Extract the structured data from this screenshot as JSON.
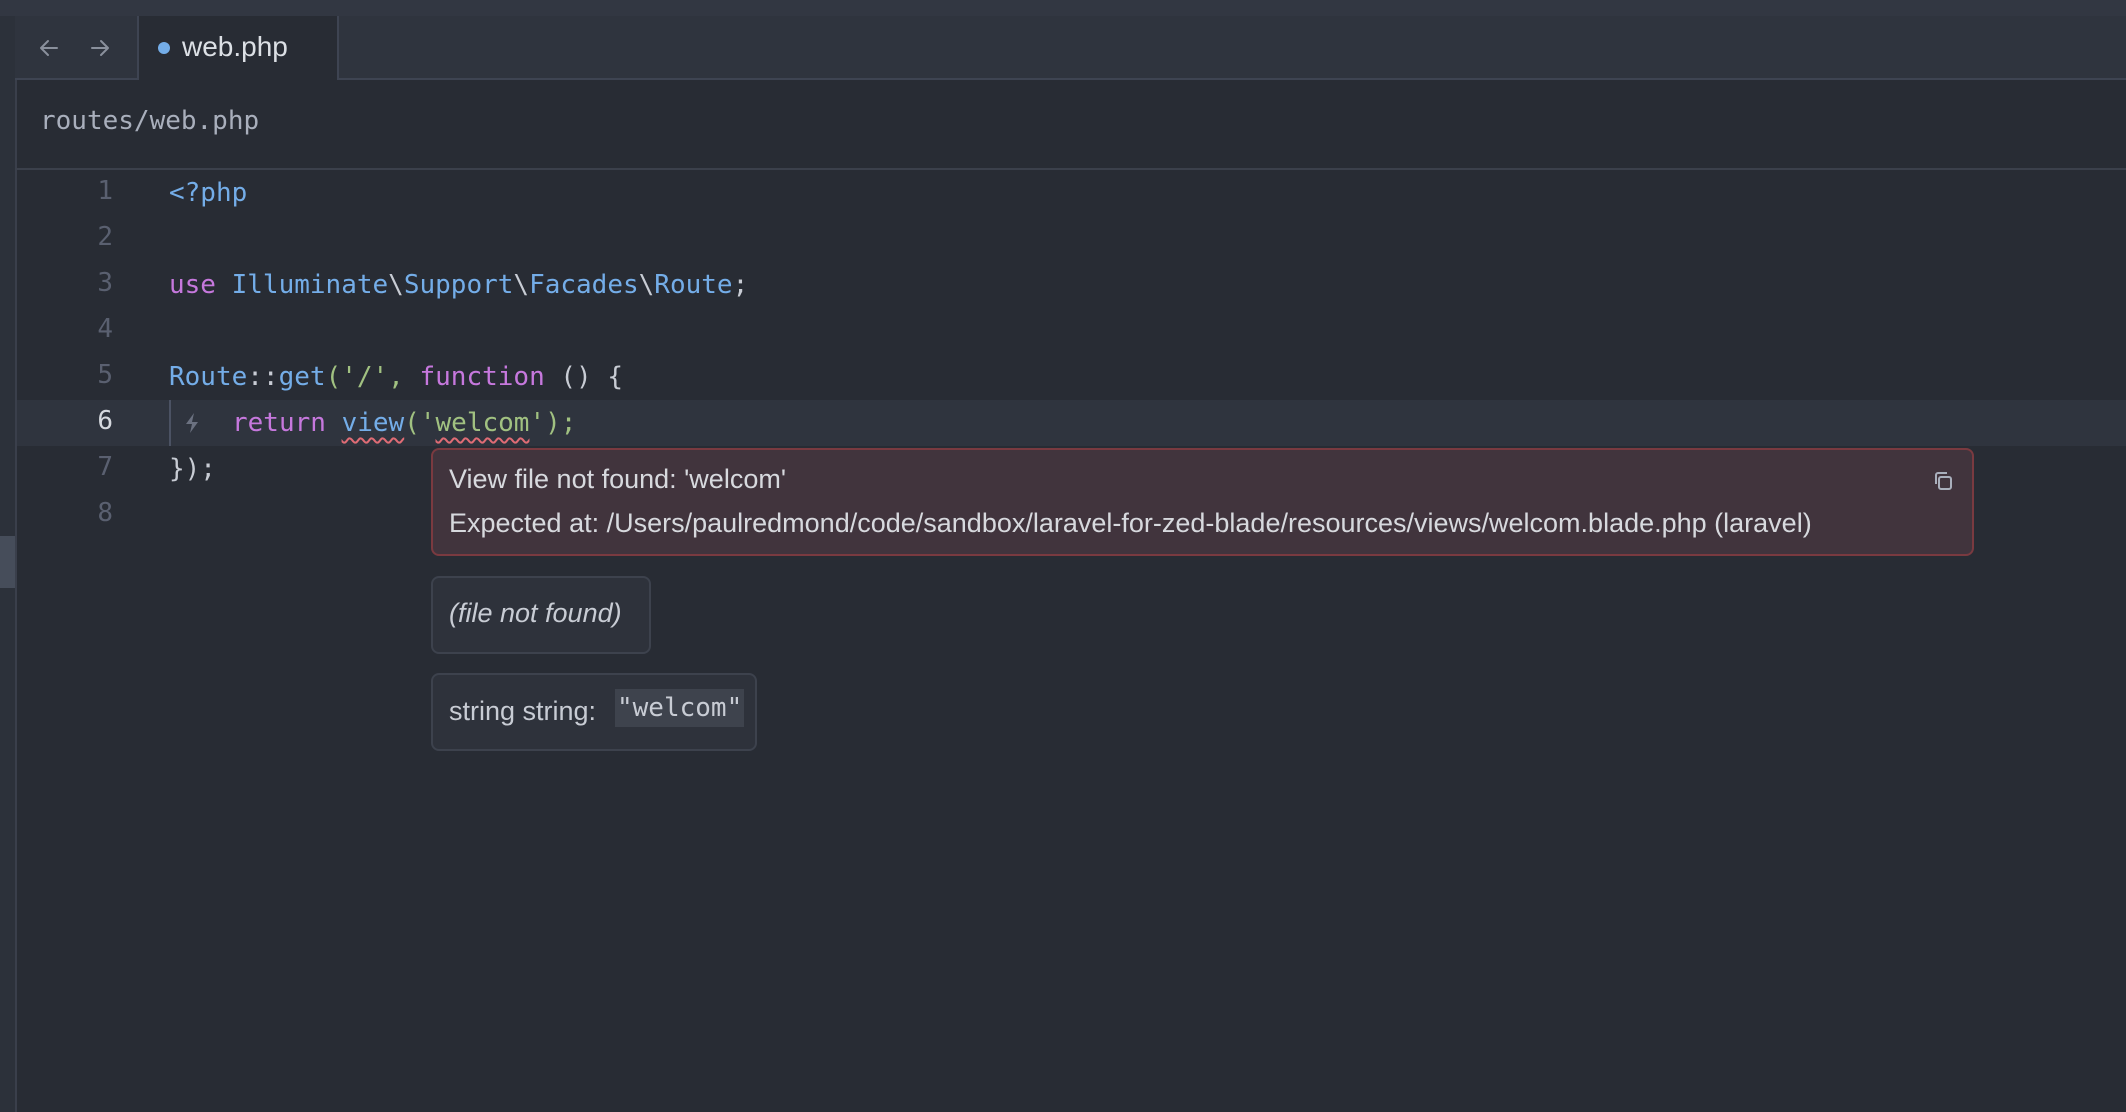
{
  "tab": {
    "label": "web.php"
  },
  "breadcrumb": {
    "path": "routes/web.php"
  },
  "editor": {
    "current_line": 6,
    "line_numbers": [
      "1",
      "2",
      "3",
      "4",
      "5",
      "6",
      "7",
      "8"
    ],
    "lines": {
      "l1": {
        "tag": "<?php"
      },
      "l3": {
        "kw": "use",
        "sp": " ",
        "ns1": "Illuminate",
        "sep1": "\\",
        "ns2": "Support",
        "sep2": "\\",
        "ns3": "Facades",
        "sep3": "\\",
        "ns4": "Route",
        "end": ";"
      },
      "l5": {
        "cls": "Route",
        "op": "::",
        "fn": "get",
        "open": "('",
        "path": "/",
        "mid": "', ",
        "kw": "function",
        "tail": " () {"
      },
      "l6": {
        "kw": "return",
        "sp": " ",
        "fn": "view",
        "open": "('",
        "arg": "welcom",
        "close": "');"
      },
      "l7": {
        "text": "});"
      }
    }
  },
  "diagnostic": {
    "message": "View file not found: 'welcom'",
    "detail": "Expected at: /Users/paulredmond/code/sandbox/laravel-for-zed-blade/resources/views/welcom.blade.php (laravel)"
  },
  "hover_file": {
    "text": "(file not found)"
  },
  "hover_type": {
    "label": "string string: ",
    "value": "\"welcom\""
  },
  "colors": {
    "accent": "#74ade8",
    "error_border": "#7a3a40",
    "keyword": "#c678dd",
    "string": "#a1c181"
  }
}
